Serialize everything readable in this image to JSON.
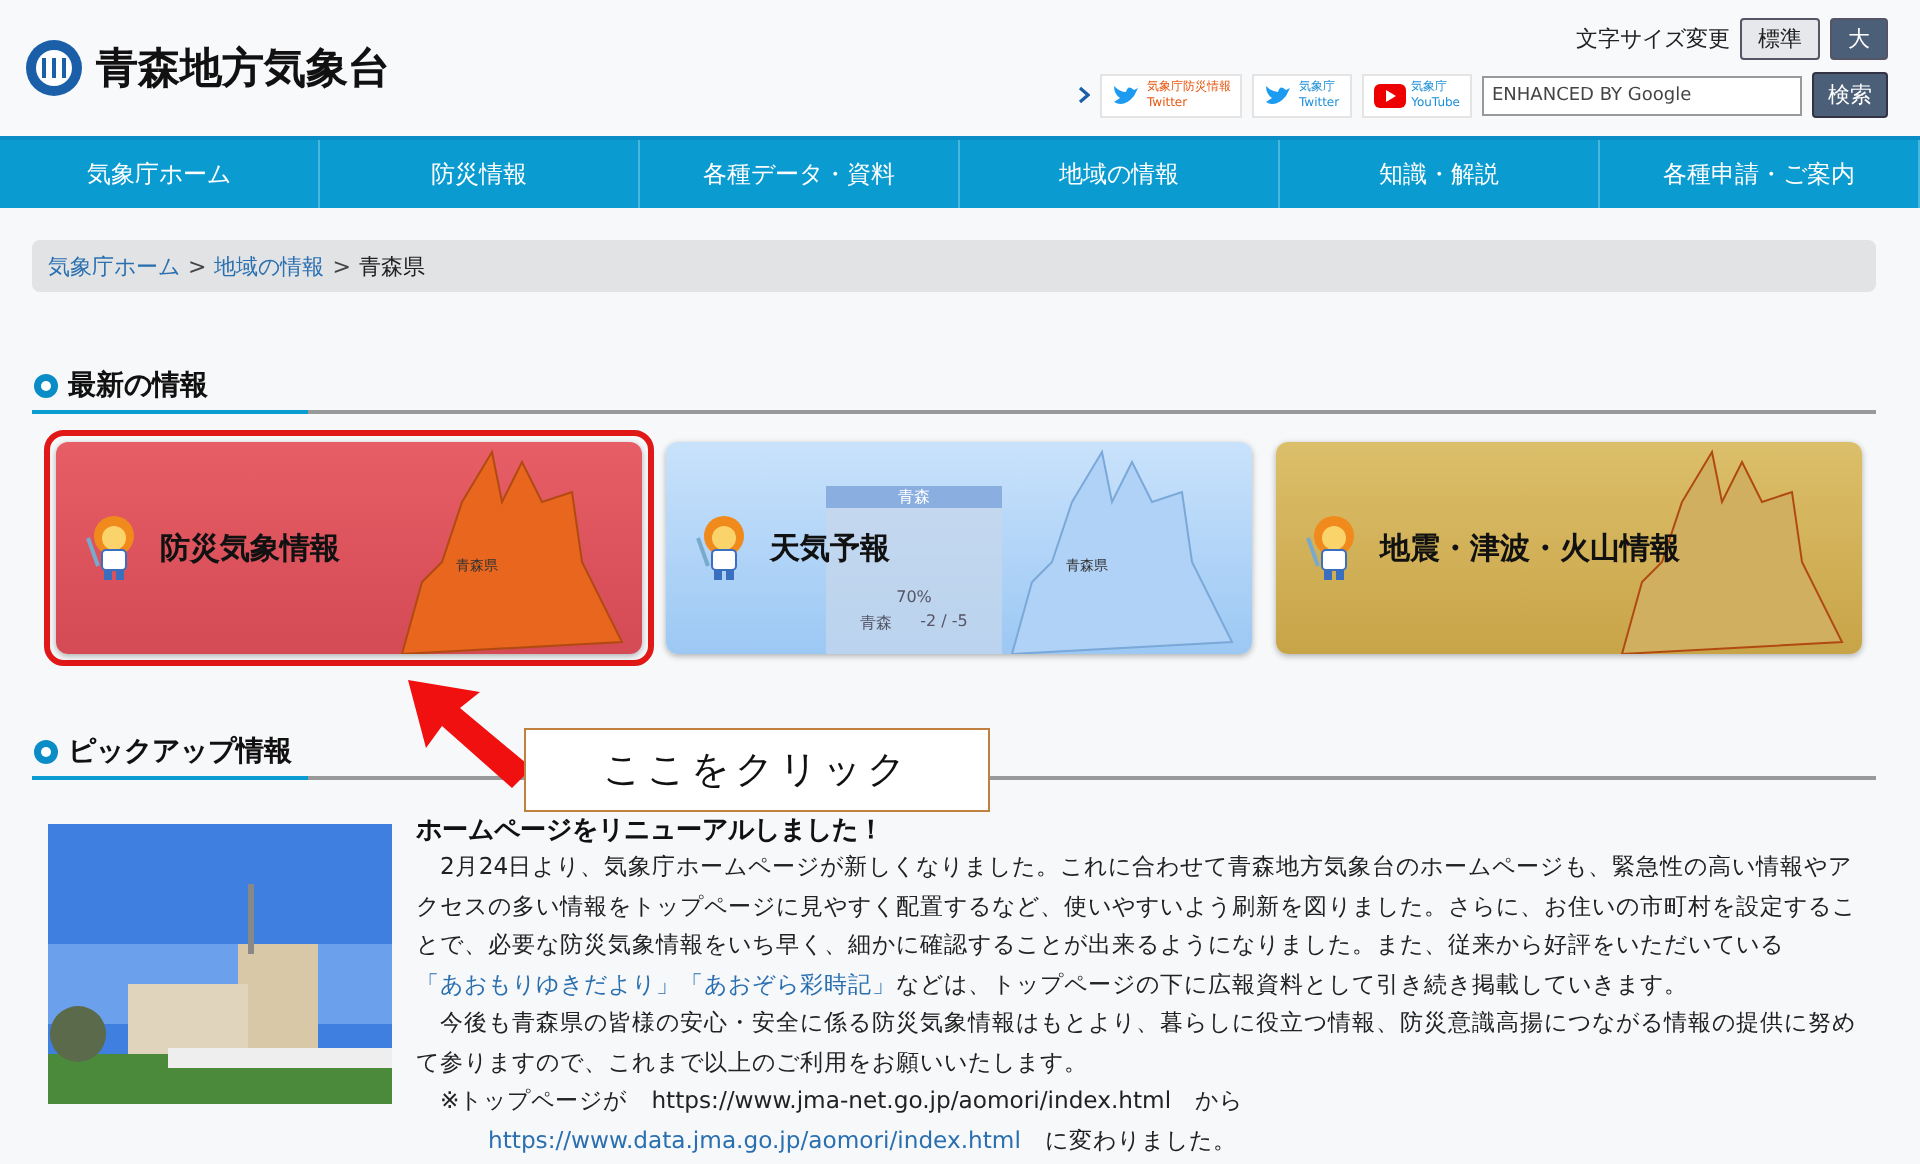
{
  "header": {
    "title": "青森地方気象台",
    "font_size": {
      "label": "文字サイズ変更",
      "options": [
        {
          "label": "標準",
          "selected": true
        },
        {
          "label": "大",
          "selected": false
        }
      ]
    },
    "social": [
      {
        "kind": "twitter",
        "name": "気象庁防災情報",
        "service": "Twitter",
        "color": "#e8560f"
      },
      {
        "kind": "twitter",
        "name": "気象庁",
        "service": "Twitter",
        "color": "#1d8fd8"
      },
      {
        "kind": "youtube",
        "name": "気象庁",
        "service": "YouTube",
        "color": "#1d8fd8"
      }
    ],
    "search": {
      "placeholder": "ENHANCED BY Google",
      "button": "検索"
    }
  },
  "nav": [
    "気象庁ホーム",
    "防災情報",
    "各種データ・資料",
    "地域の情報",
    "知識・解説",
    "各種申請・ご案内"
  ],
  "breadcrumb": [
    {
      "kind": "link",
      "label": "気象庁ホーム"
    },
    {
      "kind": "separator",
      "label": ">"
    },
    {
      "kind": "link",
      "label": "地域の情報"
    },
    {
      "kind": "separator",
      "label": ">"
    },
    {
      "kind": "current",
      "label": "青森県"
    }
  ],
  "latest": {
    "heading": "最新の情報",
    "cards": [
      {
        "kind": "warning",
        "title": "防災気象情報",
        "map_label": "青森県",
        "highlighted": true
      },
      {
        "kind": "forecast",
        "title": "天気予報",
        "map_label": "青森県",
        "highlighted": false,
        "panel": {
          "city": "青森",
          "pop": "70%",
          "row_city": "青森",
          "temps": "-2 / -5"
        }
      },
      {
        "kind": "quake",
        "title": "地震・津波・火山情報",
        "highlighted": false
      }
    ]
  },
  "callout": "ここをクリック",
  "pickup": {
    "heading": "ピックアップ情報",
    "article": {
      "title": "ホームページをリニューアルしました！",
      "paragraphs": [
        {
          "kind": "normal",
          "segments": [
            {
              "kind": "text",
              "text": "　2月24日より、気象庁ホームページが新しくなりました。これに合わせて青森地方気象台のホームページも、緊急性の高い情報やアクセスの多い情報をトップページに見やすく配置するなど、使いやすいよう刷新を図りました。さらに、お住いの市町村を設定することで、必要な防災気象情報をいち早く、細かに確認することが出来るようになりました。また、従来から好評をいただいている"
            },
            {
              "kind": "link",
              "text": "「あおもりゆきだより」"
            },
            {
              "kind": "link",
              "text": "「あおぞら彩時記」"
            },
            {
              "kind": "text",
              "text": "などは、トップページの下に広報資料として引き続き掲載していきます。"
            }
          ]
        },
        {
          "kind": "normal",
          "segments": [
            {
              "kind": "text",
              "text": "　今後も青森県の皆様の安心・安全に係る防災気象情報はもとより、暮らしに役立つ情報、防災意識高揚につながる情報の提供に努めて参りますので、これまで以上のご利用をお願いいたします。"
            }
          ]
        },
        {
          "kind": "normal",
          "segments": [
            {
              "kind": "text",
              "text": "　※トップページが　https://www.jma-net.go.jp/aomori/index.html　から"
            }
          ]
        },
        {
          "kind": "continuation",
          "segments": [
            {
              "kind": "link",
              "text": "https://www.data.jma.go.jp/aomori/index.html"
            },
            {
              "kind": "text",
              "text": "　に変わりました。"
            }
          ]
        }
      ]
    }
  }
}
